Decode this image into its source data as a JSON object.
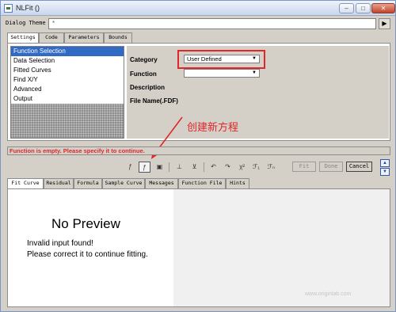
{
  "window": {
    "title": "NLFit ()",
    "controls": {
      "minimize": "–",
      "maximize": "□",
      "close": "✕"
    }
  },
  "dialog_theme": {
    "label": "Dialog Theme",
    "value": "*",
    "arrow": "▶"
  },
  "top_tabs": [
    "Settings",
    "Code",
    "Parameters",
    "Bounds"
  ],
  "tree": {
    "items": [
      "Function Selection",
      "Data Selection",
      "Fitted Curves",
      "Find X/Y",
      "Advanced",
      "Output"
    ],
    "selected_index": 0
  },
  "properties": {
    "category_label": "Category",
    "category_value": "User Defined",
    "function_label": "Function",
    "function_value": "",
    "description_label": "Description",
    "filename_label": "File Name(.FDF)"
  },
  "annotation": {
    "text": "创建新方程",
    "color": "#e0262a"
  },
  "status": {
    "message": "Function is empty. Please specify it to continue."
  },
  "toolbar": {
    "tool_icons": [
      "new-function-icon",
      "create-function-icon",
      "save-function-icon",
      "param-initial-icon",
      "param-fix-icon",
      "undo-icon",
      "redo-icon",
      "chi-square-icon",
      "iterate-1-icon",
      "iterate-many-icon"
    ],
    "fit_label": "Fit",
    "done_label": "Done",
    "cancel_label": "Cancel",
    "up_arrow": "▲",
    "down_arrow": "▼"
  },
  "bottom_tabs": [
    "Fit Curve",
    "Residual",
    "Formula",
    "Sample Curve",
    "Messages",
    "Function File",
    "Hints"
  ],
  "preview": {
    "title": "No Preview",
    "line1": "Invalid input found!",
    "line2": "Please correct it to continue fitting."
  },
  "watermark": "www.originlab.com"
}
